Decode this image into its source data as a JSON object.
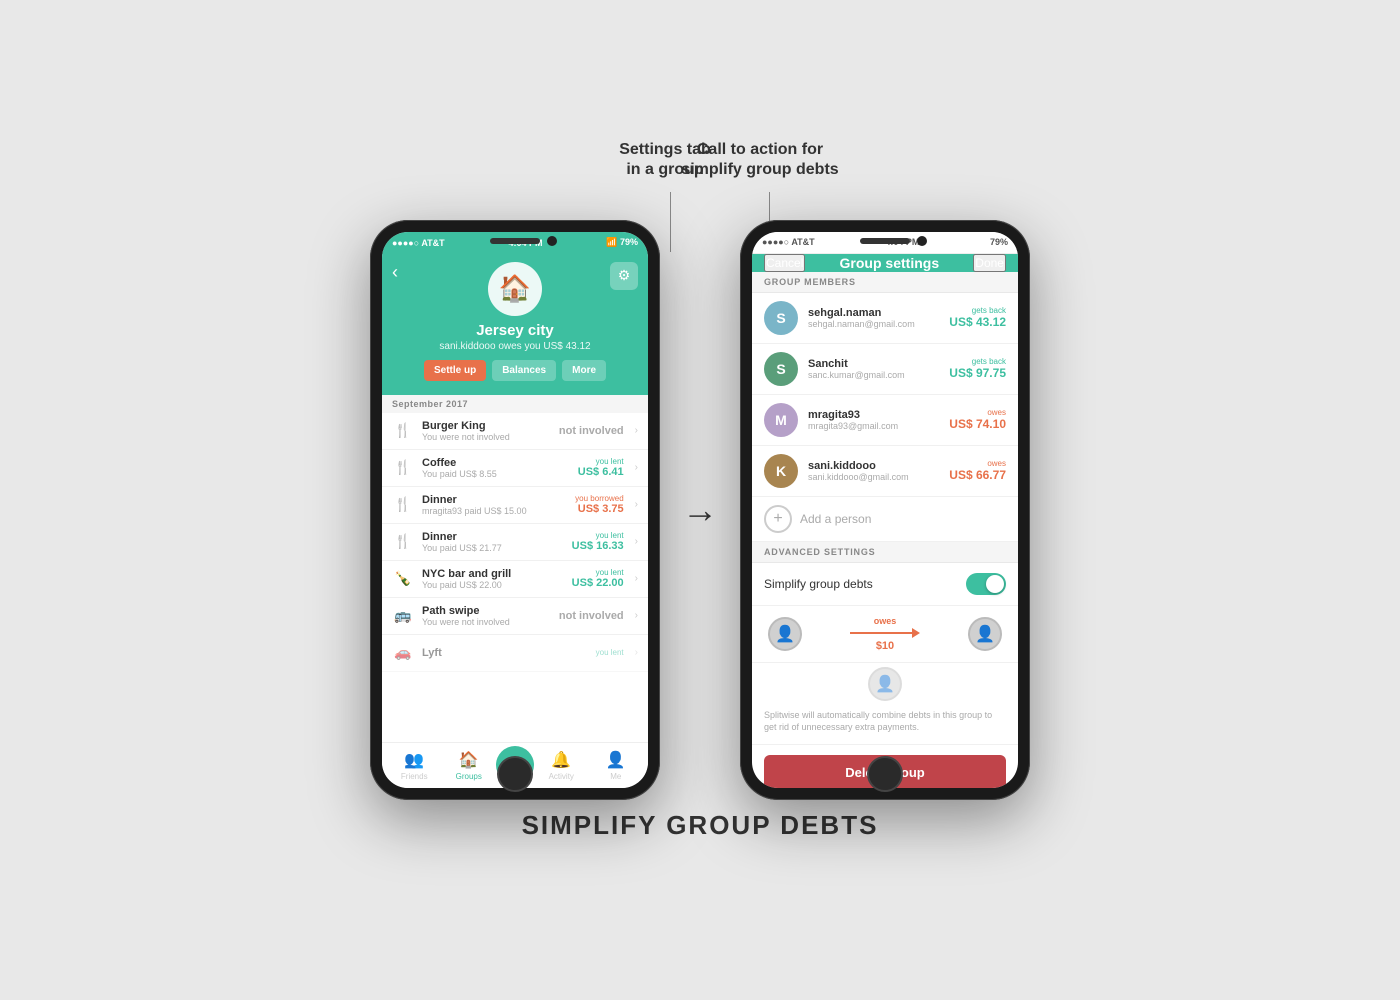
{
  "page": {
    "title": "SIMPLIFY GROUP DEBTS",
    "bg_color": "#e8e8e8"
  },
  "annotations": {
    "left_label": "Settings tab\nin a group",
    "right_label": "Call to action for\nsimplify group debts"
  },
  "phone1": {
    "status_bar": {
      "carrier": "●●●●○ AT&T",
      "time": "4:04 PM",
      "battery": "79%"
    },
    "header": {
      "group_name": "Jersey city",
      "subtitle": "sani.kiddooo owes you US$ 43.12",
      "btn_settle": "Settle up",
      "btn_balances": "Balances",
      "btn_more": "More"
    },
    "section": "September 2017",
    "expenses": [
      {
        "icon": "🍴",
        "name": "Burger King",
        "desc": "You were not involved",
        "label": "not involved",
        "amount": "",
        "type": "neutral"
      },
      {
        "icon": "🍴",
        "name": "Coffee",
        "desc": "You paid US$ 8.55",
        "label": "you lent",
        "amount": "US$ 6.41",
        "type": "lent"
      },
      {
        "icon": "🍴",
        "name": "Dinner",
        "desc": "mragita93 paid US$ 15.00",
        "label": "you borrowed",
        "amount": "US$ 3.75",
        "type": "borrowed"
      },
      {
        "icon": "🍴",
        "name": "Dinner",
        "desc": "You paid US$ 21.77",
        "label": "you lent",
        "amount": "US$ 16.33",
        "type": "lent"
      },
      {
        "icon": "🍾",
        "name": "NYC bar and grill",
        "desc": "You paid US$ 22.00",
        "label": "you lent",
        "amount": "US$ 22.00",
        "type": "lent"
      },
      {
        "icon": "🚌",
        "name": "Path swipe",
        "desc": "You were not involved",
        "label": "not involved",
        "amount": "",
        "type": "neutral"
      },
      {
        "icon": "🚗",
        "name": "Lyft",
        "desc": "",
        "label": "you lent",
        "amount": "",
        "type": "lent"
      }
    ],
    "tabs": [
      "Friends",
      "Groups",
      "+",
      "Activity",
      "Me"
    ]
  },
  "phone2": {
    "status_bar": {
      "carrier": "●●●●○ AT&T",
      "time": "4:04 PM",
      "battery": "79%"
    },
    "header": {
      "cancel": "Cancel",
      "title": "Group settings",
      "done": "Done"
    },
    "sections": {
      "group_members": "GROUP MEMBERS",
      "advanced_settings": "ADVANCED SETTINGS"
    },
    "members": [
      {
        "name": "sehgal.naman",
        "email": "sehgal.naman@gmail.com",
        "label": "gets back",
        "amount": "US$ 43.12",
        "type": "gets",
        "color": "#7ab5c8",
        "initial": "S"
      },
      {
        "name": "Sanchit",
        "email": "sanc.kumar@gmail.com",
        "label": "gets back",
        "amount": "US$ 97.75",
        "type": "gets",
        "color": "#5a9e7a",
        "initial": "S"
      },
      {
        "name": "mragita93",
        "email": "mragita93@gmail.com",
        "label": "owes",
        "amount": "US$ 74.10",
        "type": "owes",
        "color": "#b5a0c8",
        "initial": "M"
      },
      {
        "name": "sani.kiddooo",
        "email": "sani.kiddooo@gmail.com",
        "label": "owes",
        "amount": "US$ 66.77",
        "type": "owes",
        "color": "#a88550",
        "initial": "K"
      }
    ],
    "add_person": "Add a person",
    "simplify_label": "Simplify group debts",
    "simplify_toggle": true,
    "debt_diagram": {
      "owes_label": "owes",
      "amount": "$10"
    },
    "simplify_desc": "Splitwise will automatically combine debts in this group to get rid of unnecessary extra payments.",
    "delete_btn": "Delete group"
  }
}
